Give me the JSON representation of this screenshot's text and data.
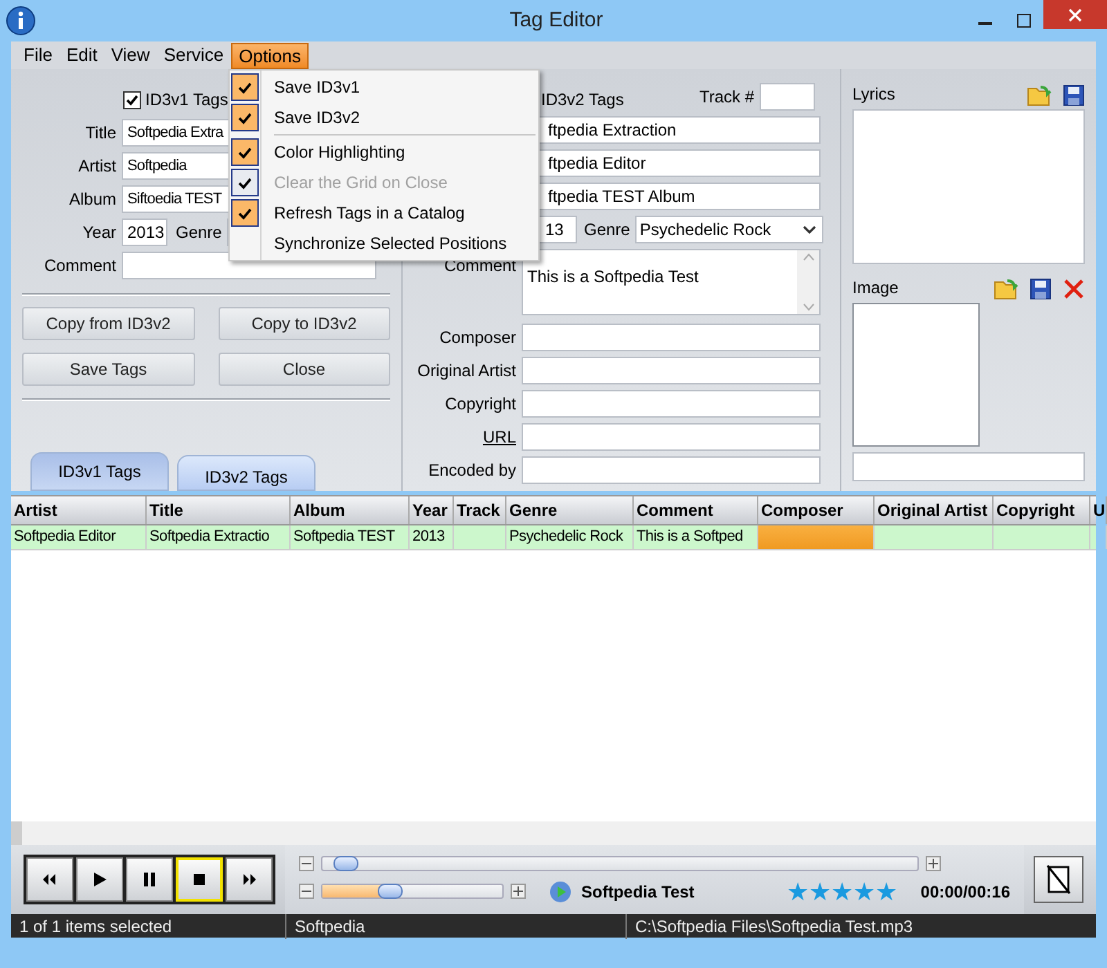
{
  "window": {
    "title": "Tag Editor"
  },
  "menu_bar": [
    {
      "label": "File",
      "selected": false
    },
    {
      "label": "Edit",
      "selected": false
    },
    {
      "label": "View",
      "selected": false
    },
    {
      "label": "Service",
      "selected": false
    },
    {
      "label": "Options",
      "selected": true
    }
  ],
  "options_menu": [
    {
      "label": "Save ID3v1",
      "checked": true,
      "disabled": false
    },
    {
      "label": "Save ID3v2",
      "checked": true,
      "disabled": false,
      "separator_after": true
    },
    {
      "label": "Color Highlighting",
      "checked": true,
      "disabled": false
    },
    {
      "label": "Clear the Grid on Close",
      "checked": true,
      "disabled": true
    },
    {
      "label": "Refresh Tags in a Catalog",
      "checked": true,
      "disabled": false
    },
    {
      "label": "Synchronize Selected Positions",
      "checked": false,
      "disabled": false
    }
  ],
  "id3v1": {
    "enabled_label": "ID3v1 Tags",
    "enabled": true,
    "fields": [
      {
        "label": "Title",
        "value": "Softpedia Extra"
      },
      {
        "label": "Artist",
        "value": "Softpedia"
      },
      {
        "label": "Album",
        "value": "Siftoedia TEST"
      }
    ],
    "year": {
      "label": "Year",
      "value": "2013"
    },
    "genre_label": "Genre",
    "comment_label": "Comment",
    "buttons": [
      "Copy from ID3v2",
      "Copy to ID3v2",
      "Save Tags",
      "Close"
    ]
  },
  "tabs": [
    {
      "label": "ID3v1 Tags",
      "selected": true
    },
    {
      "label": "ID3v2 Tags",
      "selected": false
    }
  ],
  "id3v2": {
    "enabled_label": "ID3v2 Tags",
    "track_label": "Track #",
    "fields": [
      {
        "value": "ftpedia Extraction"
      },
      {
        "value": "ftpedia Editor"
      },
      {
        "value": "ftpedia TEST Album"
      }
    ],
    "year": {
      "value": "13"
    },
    "genre": {
      "label": "Genre",
      "value": "Psychedelic Rock"
    },
    "comment": {
      "label": "Comment",
      "value": "This is a Softpedia Test"
    },
    "extra_fields": [
      {
        "label": "Composer",
        "kind": "text"
      },
      {
        "label": "Original Artist",
        "kind": "text"
      },
      {
        "label": "Copyright",
        "kind": "text"
      },
      {
        "label": "URL",
        "kind": "link"
      },
      {
        "label": "Encoded by",
        "kind": "text"
      }
    ]
  },
  "lyrics": {
    "label": "Lyrics"
  },
  "image": {
    "label": "Image"
  },
  "table": {
    "columns": [
      "Artist",
      "Title",
      "Album",
      "Year",
      "Track",
      "Genre",
      "Comment",
      "Composer",
      "Original Artist",
      "Copyright",
      "U"
    ],
    "rows": [
      {
        "selected": true,
        "cells": [
          "Softpedia Editor",
          "Softpedia Extractio",
          "Softpedia TEST",
          "2013",
          "",
          "Psychedelic Rock",
          "This is a Softped",
          "",
          "",
          "",
          ""
        ]
      }
    ]
  },
  "player": {
    "buttons": [
      {
        "kind": "previous",
        "selected": false
      },
      {
        "kind": "play",
        "selected": false
      },
      {
        "kind": "pause",
        "selected": false
      },
      {
        "kind": "stop",
        "selected": true
      },
      {
        "kind": "next",
        "selected": false
      }
    ],
    "position": {
      "level": 0.02
    },
    "volume": {
      "level": 0.36
    },
    "track_title": "Softpedia Test",
    "stars": 5,
    "time": "00:00/00:16"
  },
  "status_bar": [
    "1 of 1 items selected",
    "Softpedia",
    "C:\\Softpedia Files\\Softpedia Test.mp3"
  ]
}
